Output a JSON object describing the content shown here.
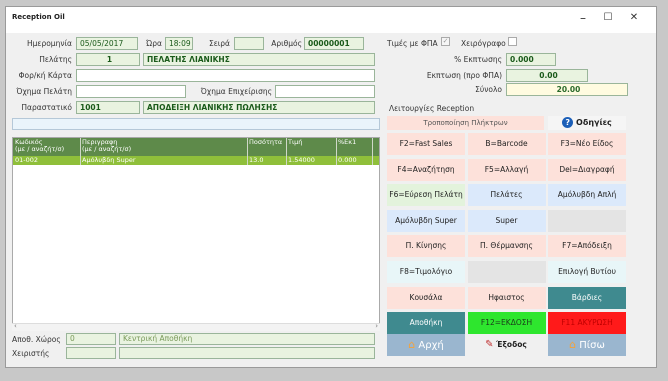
{
  "window": {
    "title": "Reception Oil",
    "min": "–",
    "max": "☐",
    "close": "✕"
  },
  "header": {
    "date_label": "Ημερομηνία",
    "date_value": "05/05/2017",
    "time_label": "Ώρα",
    "time_value": "18:09",
    "series_label": "Σειρά",
    "series_value": "",
    "number_label": "Αριθμός",
    "number_value": "00000001",
    "customer_label": "Πελάτης",
    "customer_code": "1",
    "customer_name": "ΠΕΛΑΤΗΣ ΛΙΑΝΙΚΗΣ",
    "vat_label": "Φορ/κή Κάρτα",
    "vat_value": "",
    "vehicle_label": "Όχημα Πελάτη",
    "vehicle_value": "",
    "company_vehicle_label": "Όχημα Επιχείρισης",
    "company_vehicle_value": "",
    "doc_label": "Παραστατικό",
    "doc_code": "1001",
    "doc_name": "ΑΠΟΔΕΙΞΗ ΛΙΑΝΙΚΗΣ ΠΩΛΗΣΗΣ"
  },
  "totals": {
    "vat_prices_label": "Τιμές με ΦΠΑ",
    "handwritten_label": "Χειρόγραφο",
    "discount_pct_label": "% Εκπτωσης",
    "discount_pct_value": "0.000",
    "discount_label": "Εκπτωση (προ ΦΠΑ)",
    "discount_value": "0.00",
    "total_label": "Σύνολο",
    "total_value": "20.00"
  },
  "grid": {
    "columns": [
      {
        "line1": "Κωδικός",
        "line2": "(με / αναζήτ/σ)"
      },
      {
        "line1": "Περιγραφη",
        "line2": "(με / αναζήτ/σ)"
      },
      {
        "line1": "Ποσότητα",
        "line2": ""
      },
      {
        "line1": "Τιμή",
        "line2": ""
      },
      {
        "line1": "%Εκ1",
        "line2": ""
      }
    ],
    "rows": [
      {
        "code": "01-002",
        "desc": "Αμόλυβδη Super",
        "qty": "13.0",
        "price": "1.54000",
        "disc": "0.000"
      }
    ]
  },
  "footer": {
    "store_label": "Αποθ. Χώρος",
    "store_code": "0",
    "store_name": "Κεντρική Αποθήκη",
    "operator_label": "Χειριστής",
    "operator_value": ""
  },
  "reception": {
    "section_label": "Λειτουργίες Reception",
    "modify_keys": "Τροποποίηση Πλήκτρων",
    "guides": "Οδηγίες",
    "buttons": [
      {
        "label": "F2=Fast Sales",
        "color": "#fde1da",
        "text": "#222"
      },
      {
        "label": "B=Barcode",
        "color": "#fde1da",
        "text": "#222"
      },
      {
        "label": "F3=Νέο Είδος",
        "color": "#fde1da",
        "text": "#222"
      },
      {
        "label": "F4=Αναζήτηση",
        "color": "#fde1da",
        "text": "#222"
      },
      {
        "label": "F5=Αλλαγή",
        "color": "#fde1da",
        "text": "#222"
      },
      {
        "label": "Del=Διαγραφή",
        "color": "#fde1da",
        "text": "#222"
      },
      {
        "label": "F6=Εύρεση Πελάτη",
        "color": "#e3f3dc",
        "text": "#222"
      },
      {
        "label": "Πελάτες",
        "color": "#dbe9fb",
        "text": "#222"
      },
      {
        "label": "Αμόλυβδη Απλή",
        "color": "#dbe9fb",
        "text": "#222"
      },
      {
        "label": "Αμόλυβδη Super",
        "color": "#dbe9fb",
        "text": "#222"
      },
      {
        "label": "Super",
        "color": "#dbe9fb",
        "text": "#222"
      },
      {
        "label": "",
        "color": "#e4e4e4",
        "text": "#222"
      },
      {
        "label": "Π. Κίνησης",
        "color": "#fde1da",
        "text": "#222"
      },
      {
        "label": "Π. Θέρμανσης",
        "color": "#fde1da",
        "text": "#222"
      },
      {
        "label": "F7=Απόδειξη",
        "color": "#fde1da",
        "text": "#222"
      },
      {
        "label": "F8=Τιμολόγιο",
        "color": "#e8f6f8",
        "text": "#222"
      },
      {
        "label": "",
        "color": "#e4e4e4",
        "text": "#222"
      },
      {
        "label": "Επιλογή Βυτίου",
        "color": "#e8f6f8",
        "text": "#222"
      },
      {
        "label": "Κουσάλα",
        "color": "#fde1da",
        "text": "#222"
      },
      {
        "label": "Ηφαιστος",
        "color": "#fde1da",
        "text": "#222"
      },
      {
        "label": "Βάρδιες",
        "color": "#3f8a8f",
        "text": "#ffffff"
      },
      {
        "label": "Αποθήκη",
        "color": "#3f8a8f",
        "text": "#ffffff"
      },
      {
        "label": "F12=ΕΚΔΟΣΗ",
        "color": "#2ee62e",
        "text": "#1a3a1a"
      },
      {
        "label": "F11 ΑΚΥΡΩΣΗ",
        "color": "#ff1a1a",
        "text": "#c00000"
      }
    ],
    "nav": {
      "home": "Αρχή",
      "exit": "Έξοδος",
      "back": "Πίσω"
    }
  }
}
